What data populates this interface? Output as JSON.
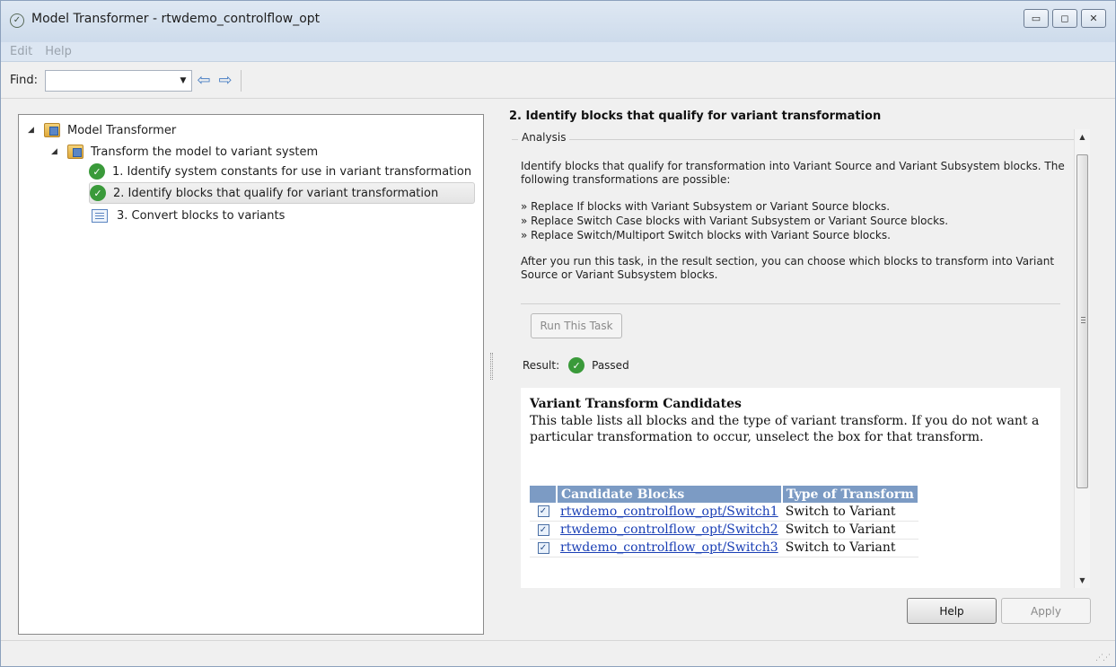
{
  "window": {
    "title": "Model Transformer - rtwdemo_controlflow_opt",
    "buttons": [
      "minimize",
      "maximize",
      "close"
    ]
  },
  "menu": {
    "items": [
      "Edit",
      "Help"
    ]
  },
  "toolbar": {
    "find_label": "Find:",
    "find_value": "",
    "back_icon": "arrow-left-icon",
    "forward_icon": "arrow-right-icon"
  },
  "tree": {
    "root": {
      "label": "Model Transformer",
      "icon": "folder-icon",
      "expanded": true
    },
    "group": {
      "label": "Transform the model to variant system",
      "icon": "folder-icon",
      "expanded": true
    },
    "tasks": [
      {
        "label": "1. Identify system constants for use in variant transformation",
        "icon": "check-icon",
        "status": "passed"
      },
      {
        "label": "2. Identify blocks that qualify for variant transformation",
        "icon": "check-icon",
        "status": "passed",
        "selected": true
      },
      {
        "label": "3. Convert blocks to variants",
        "icon": "task-icon",
        "status": "not-run"
      }
    ]
  },
  "detail": {
    "heading": "2. Identify blocks that qualify for variant transformation",
    "analysis_label": "Analysis",
    "intro": "Identify blocks that qualify for transformation into Variant Source and Variant Subsystem blocks. The following transformations are possible:",
    "bullets": [
      "» Replace If blocks with Variant Subsystem or Variant Source blocks.",
      "» Replace Switch Case blocks with Variant Subsystem or Variant Source blocks.",
      "» Replace Switch/Multiport Switch blocks with Variant Source blocks."
    ],
    "after": "After you run this task, in the result section, you can choose which blocks to transform into Variant Source or Variant Subsystem blocks.",
    "run_button": "Run This Task",
    "result_label": "Result:",
    "result_value": "Passed",
    "report": {
      "title": "Variant Transform Candidates",
      "description": "This table lists all blocks and the type of variant transform. If you do not want a particular transformation to occur, unselect the box for that transform.",
      "columns": [
        "",
        "Candidate Blocks",
        "Type of Transform"
      ],
      "rows": [
        {
          "checked": true,
          "block": "rtwdemo_controlflow_opt/Switch1",
          "type": "Switch to Variant"
        },
        {
          "checked": true,
          "block": "rtwdemo_controlflow_opt/Switch2",
          "type": "Switch to Variant"
        },
        {
          "checked": true,
          "block": "rtwdemo_controlflow_opt/Switch3",
          "type": "Switch to Variant"
        }
      ]
    },
    "help_button": "Help",
    "apply_button": "Apply"
  },
  "colors": {
    "table_header": "#7c9bc4",
    "passed_green": "#3a9a3a",
    "link": "#1a3fb5"
  }
}
